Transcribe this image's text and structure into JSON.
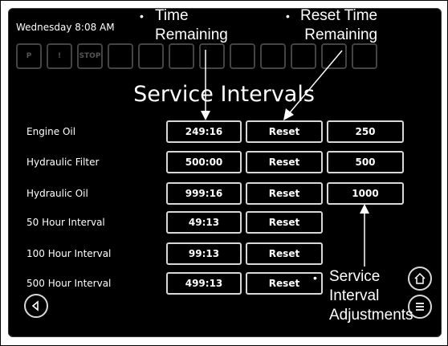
{
  "status": {
    "clock": "Wednesday 8:08 AM"
  },
  "title": "Service Intervals",
  "icons": [
    "P",
    "!",
    "STOP",
    "",
    "",
    "",
    "",
    "",
    "",
    "",
    "",
    ""
  ],
  "rows": [
    {
      "label": "Engine Oil",
      "time": "249:16",
      "reset": "Reset",
      "adjust": "250"
    },
    {
      "label": "Hydraulic Filter",
      "time": "500:00",
      "reset": "Reset",
      "adjust": "500"
    },
    {
      "label": "Hydraulic Oil",
      "time": "999:16",
      "reset": "Reset",
      "adjust": "1000"
    },
    {
      "label": "50 Hour Interval",
      "time": "49:13",
      "reset": "Reset"
    },
    {
      "label": "100 Hour Interval",
      "time": "99:13",
      "reset": "Reset"
    },
    {
      "label": "500 Hour Interval",
      "time": "499:13",
      "reset": "Reset"
    }
  ],
  "callouts": {
    "time_remaining": [
      "Time",
      "Remaining"
    ],
    "reset_time_remaining": [
      "Reset Time",
      "Remaining"
    ],
    "service_interval_adjustments": [
      "Service",
      "Interval",
      "Adjustments"
    ]
  },
  "bullet": "•"
}
